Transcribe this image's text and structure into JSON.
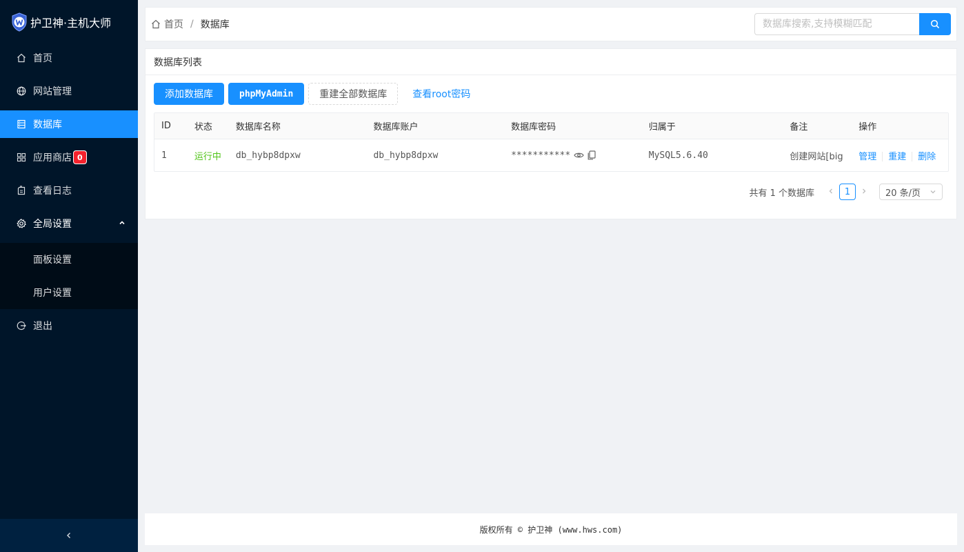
{
  "brand": {
    "title": "护卫神·主机大师",
    "logo_icon": "shield-w-icon"
  },
  "sidebar": {
    "items": [
      {
        "label": "首页",
        "icon": "home-icon"
      },
      {
        "label": "网站管理",
        "icon": "globe-icon"
      },
      {
        "label": "数据库",
        "icon": "database-icon",
        "active": true
      },
      {
        "label": "应用商店",
        "icon": "apps-icon",
        "badge": "0"
      },
      {
        "label": "查看日志",
        "icon": "log-icon"
      },
      {
        "label": "全局设置",
        "icon": "gear-icon",
        "expanded": true
      },
      {
        "label": "退出",
        "icon": "logout-icon"
      }
    ],
    "submenu": [
      {
        "label": "面板设置"
      },
      {
        "label": "用户设置"
      }
    ],
    "collapse_icon": "chevron-left-icon"
  },
  "header": {
    "breadcrumb": {
      "home": "首页",
      "sep": "/",
      "current": "数据库"
    },
    "search": {
      "placeholder": "数据库搜索,支持模糊匹配",
      "value": ""
    }
  },
  "card": {
    "title": "数据库列表",
    "toolbar": {
      "add": "添加数据库",
      "phpmyadmin": "phpMyAdmin",
      "rebuild_all": "重建全部数据库",
      "view_root": "查看root密码"
    },
    "table": {
      "headers": [
        "ID",
        "状态",
        "数据库名称",
        "数据库账户",
        "数据库密码",
        "归属于",
        "备注",
        "操作"
      ],
      "rows": [
        {
          "id": "1",
          "status": "运行中",
          "name": "db_hybp8dpxw",
          "account": "db_hybp8dpxw",
          "password": "***********",
          "owner": "MySQL5.6.40",
          "remark": "创建网站[big",
          "actions": [
            "管理",
            "重建",
            "删除"
          ]
        }
      ]
    },
    "pagination": {
      "total_text": "共有 1 个数据库",
      "current_page": "1",
      "page_size": "20 条/页"
    }
  },
  "footer": {
    "text": "版权所有 © 护卫神 (www.hws.com)"
  },
  "colors": {
    "sidebar_bg": "#001529",
    "primary": "#1890ff",
    "success": "#52c41a",
    "badge": "#f5222d"
  }
}
